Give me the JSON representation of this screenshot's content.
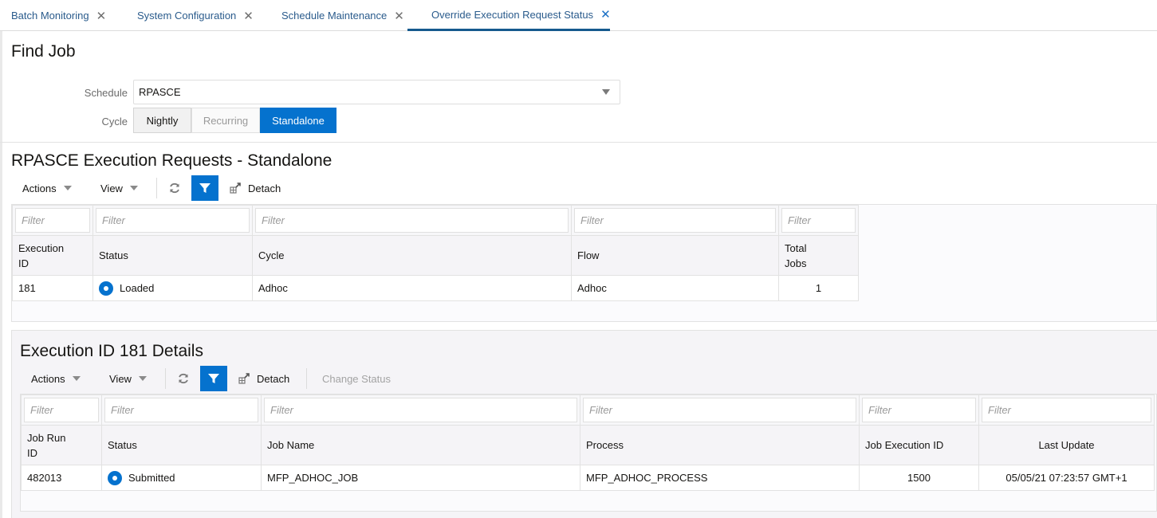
{
  "tabs": [
    {
      "label": "Batch Monitoring",
      "active": false
    },
    {
      "label": "System Configuration",
      "active": false
    },
    {
      "label": "Schedule Maintenance",
      "active": false
    },
    {
      "label": "Override Execution Request Status",
      "active": true
    }
  ],
  "find_job": {
    "title": "Find Job",
    "schedule_label": "Schedule",
    "schedule_value": "RPASCE",
    "cycle_label": "Cycle",
    "cycle_options": [
      "Nightly",
      "Recurring",
      "Standalone"
    ],
    "cycle_selected": "Standalone"
  },
  "requests": {
    "title": "RPASCE Execution Requests - Standalone",
    "toolbar": {
      "actions": "Actions",
      "view": "View",
      "detach": "Detach"
    },
    "filter_placeholder": "Filter",
    "columns": [
      "Execution ID",
      "Status",
      "Cycle",
      "Flow",
      "Total Jobs"
    ],
    "rows": [
      {
        "execution_id": "181",
        "status": "Loaded",
        "cycle": "Adhoc",
        "flow": "Adhoc",
        "total_jobs": "1"
      }
    ]
  },
  "details": {
    "title": "Execution ID 181 Details",
    "toolbar": {
      "actions": "Actions",
      "view": "View",
      "detach": "Detach",
      "change_status": "Change Status"
    },
    "filter_placeholder": "Filter",
    "columns": [
      "Job Run ID",
      "Status",
      "Job Name",
      "Process",
      "Job Execution ID",
      "Last Update"
    ],
    "rows": [
      {
        "job_run_id": "482013",
        "status": "Submitted",
        "job_name": "MFP_ADHOC_JOB",
        "process": "MFP_ADHOC_PROCESS",
        "job_execution_id": "1500",
        "last_update": "05/05/21 07:23:57 GMT+1"
      }
    ]
  },
  "colors": {
    "accent": "#0572ce",
    "tab_underline": "#155a8e",
    "tab_text": "#2a5b8c"
  }
}
